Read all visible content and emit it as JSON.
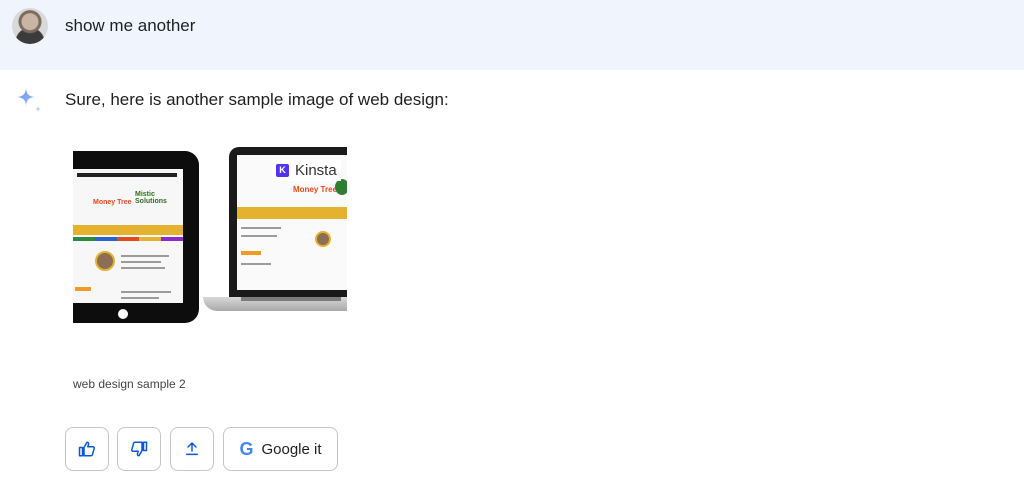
{
  "user_prompt": {
    "text": "show me another"
  },
  "response": {
    "text": "Sure, here is another sample image of web design:",
    "image": {
      "caption": "web design sample 2",
      "watermark": "Kinsta",
      "watermark_logo_letter": "K",
      "tablet_title_left": "Money Tree",
      "tablet_title_right": "Mistic Solutions",
      "laptop_title": "Money Tree"
    }
  },
  "actions": {
    "thumbs_up_icon": "thumbs-up-icon",
    "thumbs_down_icon": "thumbs-down-icon",
    "share_icon": "share-icon",
    "google_it_label": "Google it",
    "google_letter": "G"
  },
  "colors": {
    "user_bar": "#f0f4fd",
    "accent_blue": "#0b57d0",
    "kinsta_purple": "#5333ed"
  }
}
